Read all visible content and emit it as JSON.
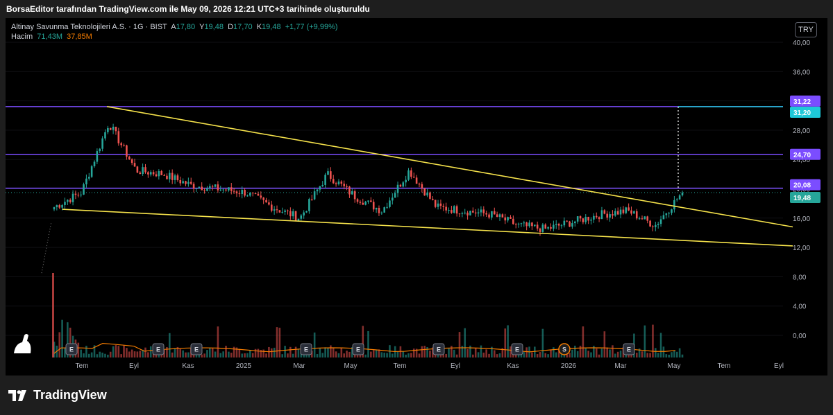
{
  "header": {
    "text": "BorsaEditor tarafından TradingView.com ile May 09, 2026 12:21 UTC+3 tarihinde oluşturuldu"
  },
  "legend": {
    "symbol": "Altinay Savunma Teknolojileri A.S. · 1G · BIST",
    "open_label": "A",
    "open": "17,80",
    "high_label": "Y",
    "high": "19,48",
    "low_label": "D",
    "low": "17,70",
    "close_label": "K",
    "close": "19,48",
    "change": "+1,77 (+9,99%)",
    "volume_label": "Hacim",
    "volume": "71,43M",
    "volume_ma": "37,85M"
  },
  "currency": "TRY",
  "price_axis": [
    "40,00",
    "36,00",
    "32,00",
    "28,00",
    "24,00",
    "20,00",
    "16,00",
    "12,00",
    "8,00",
    "4,00",
    "0,00"
  ],
  "time_axis": [
    "Tem",
    "Eyl",
    "Kas",
    "2025",
    "Mar",
    "May",
    "Tem",
    "Eyl",
    "Kas",
    "2026",
    "Mar",
    "May",
    "Tem",
    "Eyl"
  ],
  "price_labels": {
    "level1": "31,22",
    "target": "31,20",
    "level2": "24,70",
    "level3": "20,08",
    "last": "19,48"
  },
  "colors": {
    "level": "#7b4dff",
    "target": "#1ec8d8",
    "trend": "#f5e24b",
    "up": "#26a69a",
    "down": "#ef5350",
    "last": "#26a69a"
  },
  "events": [
    {
      "label": "E",
      "x": "Tem"
    },
    {
      "label": "E",
      "x": "Eyl"
    },
    {
      "label": "E",
      "x": "Kas"
    },
    {
      "label": "E",
      "x": "Mar"
    },
    {
      "label": "E",
      "x": "May"
    },
    {
      "label": "E",
      "x": "Tem"
    },
    {
      "label": "E",
      "x": "Kas"
    },
    {
      "label": "S",
      "x": "Ara"
    },
    {
      "label": "E",
      "x": "Mar"
    }
  ],
  "chart_data": {
    "type": "line",
    "title": "Altinay Savunma Teknolojileri A.S. · 1G · BIST",
    "ylim": [
      0,
      40
    ],
    "x": [
      "2024-06",
      "2024-07",
      "2024-08",
      "2024-09",
      "2024-10",
      "2024-11",
      "2024-12",
      "2025-01",
      "2025-02",
      "2025-03",
      "2025-04",
      "2025-05",
      "2025-06",
      "2025-07",
      "2025-08",
      "2025-09",
      "2025-10",
      "2025-11",
      "2025-12",
      "2026-01",
      "2026-02",
      "2026-03",
      "2026-04",
      "2026-05"
    ],
    "series": [
      {
        "values": [
          17.5,
          19.5,
          29.0,
          22.5,
          22.0,
          20.5,
          20.0,
          19.5,
          17.5,
          16.0,
          22.0,
          19.0,
          17.0,
          22.5,
          17.5,
          17.0,
          16.5,
          15.0,
          14.5,
          15.5,
          16.5,
          17.0,
          15.0,
          19.48
        ]
      }
    ],
    "horizontal_levels": [
      31.22,
      24.7,
      20.08
    ],
    "target_level": 31.2
  }
}
